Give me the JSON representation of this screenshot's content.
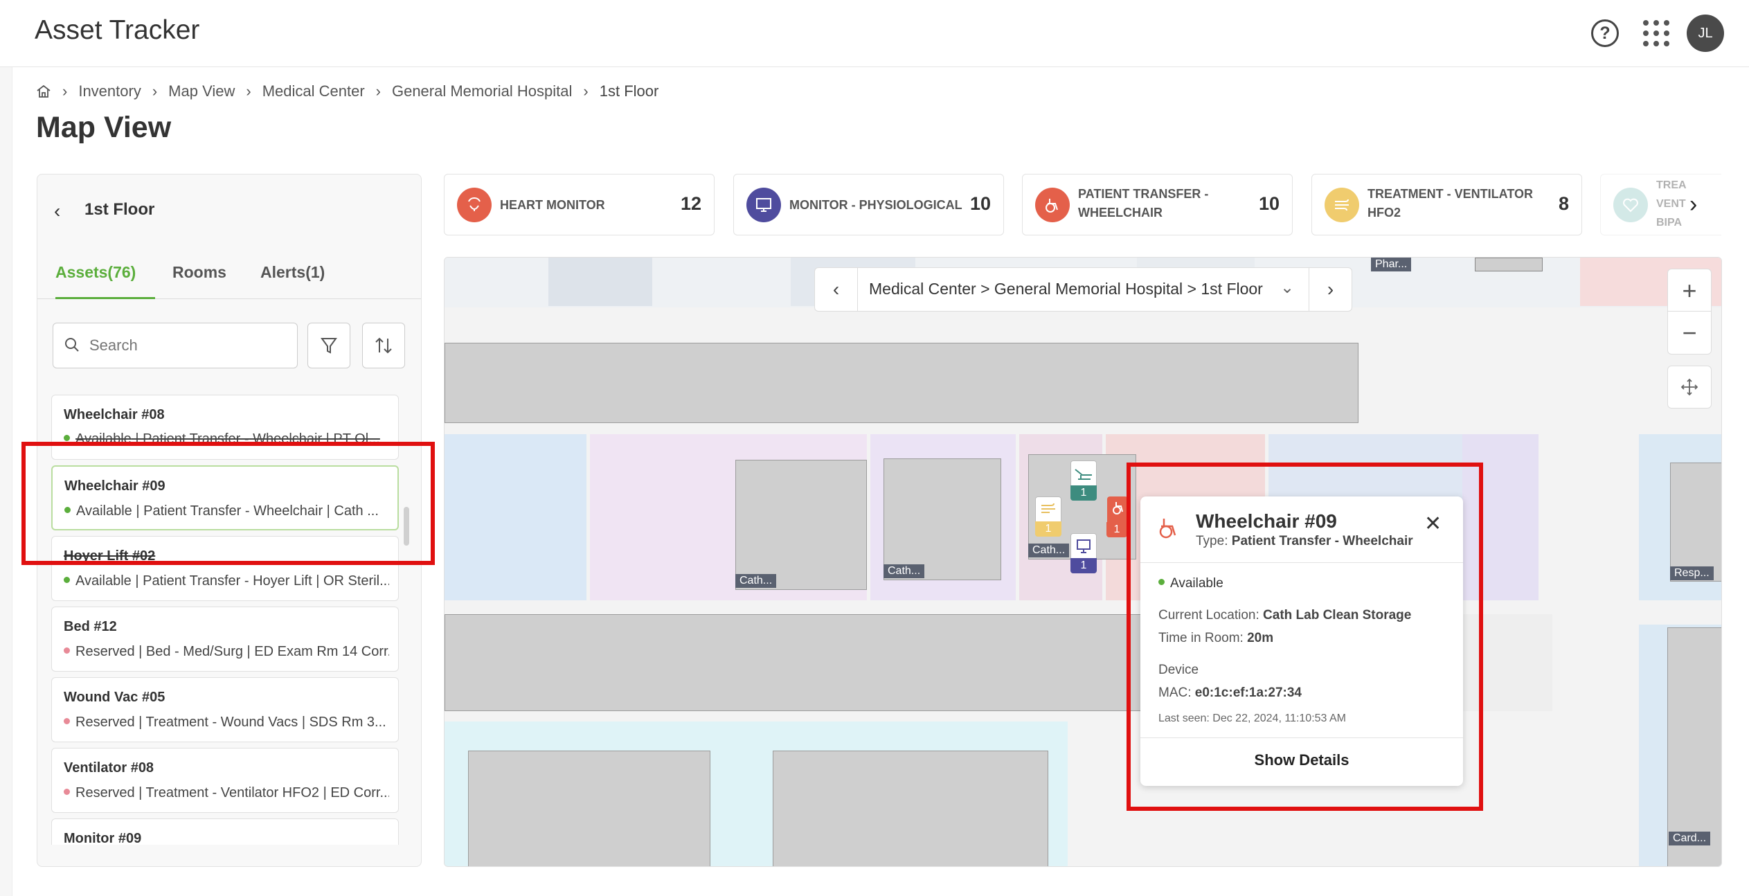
{
  "app": {
    "title": "Asset Tracker",
    "avatar_initials": "JL"
  },
  "breadcrumb": {
    "items": [
      "Inventory",
      "Map View",
      "Medical Center",
      "General Memorial Hospital"
    ],
    "current": "1st Floor"
  },
  "page_title": "Map View",
  "panel": {
    "floor_title": "1st Floor",
    "tabs": [
      {
        "label": "Assets(76)",
        "active": true
      },
      {
        "label": "Rooms",
        "active": false
      },
      {
        "label": "Alerts(1)",
        "active": false
      }
    ],
    "search_placeholder": "Search",
    "assets": [
      {
        "name": "Wheelchair #08",
        "status": "Available",
        "details": " | Patient Transfer - Wheelchair | PT Ol...",
        "status_color": "#5bae3c"
      },
      {
        "name": "Wheelchair #09",
        "status": "Available",
        "details": " | Patient Transfer - Wheelchair | Cath ...",
        "status_color": "#5bae3c",
        "selected": true
      },
      {
        "name": "Hoyer Lift #02",
        "status": "Available",
        "details": " | Patient Transfer - Hoyer Lift | OR Steril...",
        "status_color": "#5bae3c"
      },
      {
        "name": "Bed #12",
        "status": "Reserved",
        "details": " | Bed - Med/Surg | ED Exam Rm 14 Corr...",
        "status_color": "#e88a97"
      },
      {
        "name": "Wound Vac #05",
        "status": "Reserved",
        "details": " | Treatment - Wound Vacs | SDS Rm 3...",
        "status_color": "#e88a97"
      },
      {
        "name": "Ventilator #08",
        "status": "Reserved",
        "details": " | Treatment - Ventilator HFO2 | ED Corr...",
        "status_color": "#e88a97"
      },
      {
        "name": "Monitor #09",
        "status": "",
        "details": "",
        "status_color": "#5bae3c"
      }
    ]
  },
  "category_cards": [
    {
      "label_line1": "HEART MONITOR",
      "label_line2": "",
      "count": "12",
      "color": "#e4604a",
      "icon": "heart-monitor-icon"
    },
    {
      "label_line1": "MONITOR - PHYSIOLOGICAL",
      "label_line2": "",
      "count": "10",
      "color": "#4f4c9e",
      "icon": "monitor-icon"
    },
    {
      "label_line1": "PATIENT TRANSFER -",
      "label_line2": "WHEELCHAIR",
      "count": "10",
      "color": "#e4604a",
      "icon": "wheelchair-icon"
    },
    {
      "label_line1": "TREATMENT - VENTILATOR",
      "label_line2": "HFO2",
      "count": "8",
      "color": "#f0cc6e",
      "icon": "ventilator-icon"
    },
    {
      "label_line1": "TREA",
      "label_line2": "VENT",
      "label_line3": "BIPA",
      "count": "",
      "color": "#9fcfcc",
      "icon": "heart-icon"
    }
  ],
  "map": {
    "nav_path": "Medical Center > General Memorial Hospital > 1st Floor",
    "room_labels": [
      "Phar...",
      "Cath...",
      "Cath...",
      "Cath...",
      "Resp...",
      "Card..."
    ],
    "pin_counts": [
      "1",
      "1",
      "1",
      "1"
    ]
  },
  "popup": {
    "title": "Wheelchair #09",
    "type_label": "Type:",
    "type_value": "Patient Transfer - Wheelchair",
    "status": "Available",
    "location_label": "Current Location:",
    "location_value": "Cath Lab Clean Storage",
    "time_label": "Time in Room:",
    "time_value": "20m",
    "device_label": "Device",
    "mac_label": "MAC:",
    "mac_value": "e0:1c:ef:1a:27:34",
    "last_seen": "Last seen: Dec 22, 2024, 11:10:53 AM",
    "details_button": "Show Details"
  },
  "colors": {
    "accent": "#5bae3c",
    "highlight": "#e01010"
  }
}
